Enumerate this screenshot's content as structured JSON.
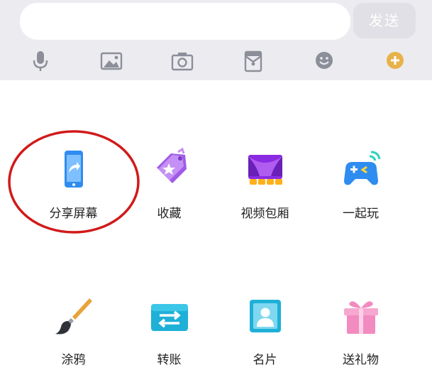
{
  "composer": {
    "input_value": "",
    "send_label": "发送"
  },
  "toolbar": [
    {
      "icon": "microphone-icon"
    },
    {
      "icon": "image-icon"
    },
    {
      "icon": "camera-icon"
    },
    {
      "icon": "red-envelope-icon"
    },
    {
      "icon": "emoji-icon"
    },
    {
      "icon": "plus-icon"
    }
  ],
  "panel": {
    "items": [
      {
        "label": "分享屏幕",
        "icon": "share-screen-icon",
        "highlighted": true
      },
      {
        "label": "收藏",
        "icon": "favorite-tag-icon"
      },
      {
        "label": "视频包厢",
        "icon": "video-theater-icon"
      },
      {
        "label": "一起玩",
        "icon": "gamepad-icon"
      },
      {
        "label": "涂鸦",
        "icon": "paintbrush-icon"
      },
      {
        "label": "转账",
        "icon": "transfer-icon"
      },
      {
        "label": "名片",
        "icon": "business-card-icon"
      },
      {
        "label": "送礼物",
        "icon": "gift-icon"
      }
    ]
  },
  "colors": {
    "top_bar_bg": "#ececf0",
    "send_button_bg": "#e0e0e6",
    "toolbar_icon": "#8c8f99",
    "plus_button": "#e8b24a",
    "highlight_ring": "#d11a1a"
  }
}
